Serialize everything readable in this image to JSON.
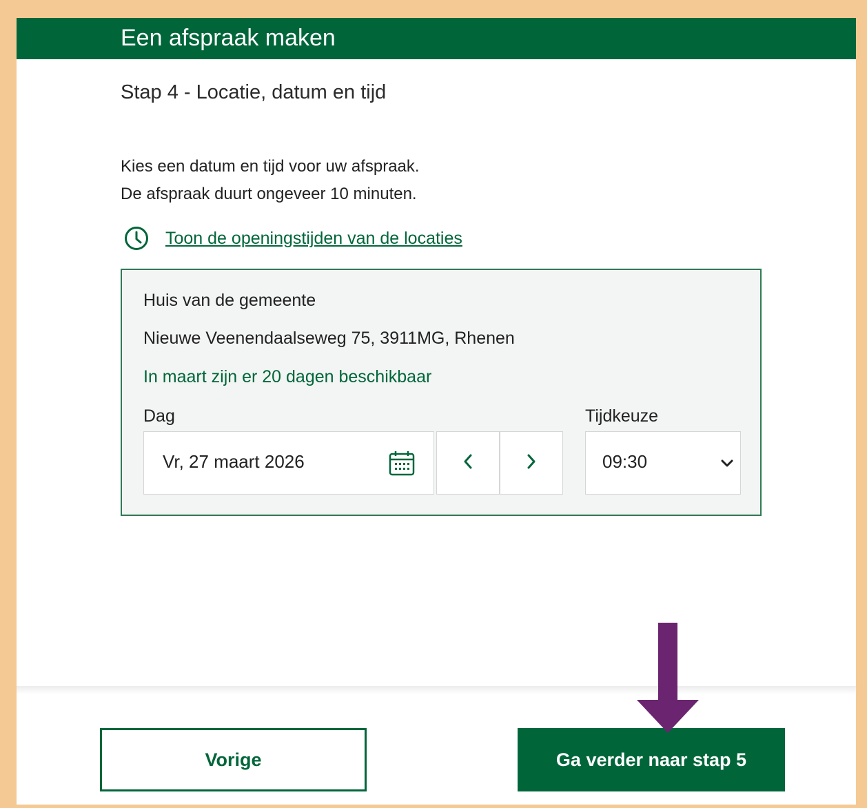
{
  "header": {
    "title": "Een afspraak maken"
  },
  "step": {
    "title": "Stap 4 - Locatie, datum en tijd"
  },
  "intro": {
    "line1": "Kies een datum en tijd voor uw afspraak.",
    "line2": "De afspraak duurt ongeveer 10 minuten."
  },
  "hours_link": {
    "label": "Toon de openingstijden van de locaties",
    "icon": "clock-icon"
  },
  "location": {
    "name": "Huis van de gemeente",
    "address": "Nieuwe Veenendaalseweg 75, 3911MG, Rhenen",
    "availability": "In maart zijn er 20 dagen beschikbaar",
    "day_label": "Dag",
    "day_value": "Vr, 27 maart 2026",
    "time_label": "Tijdkeuze",
    "time_value": "09:30"
  },
  "footer": {
    "back_label": "Vorige",
    "next_label": "Ga verder naar stap 5"
  },
  "colors": {
    "brand_green": "#00663a",
    "frame_border": "#f5c994",
    "annotation_arrow": "#6b2570"
  }
}
